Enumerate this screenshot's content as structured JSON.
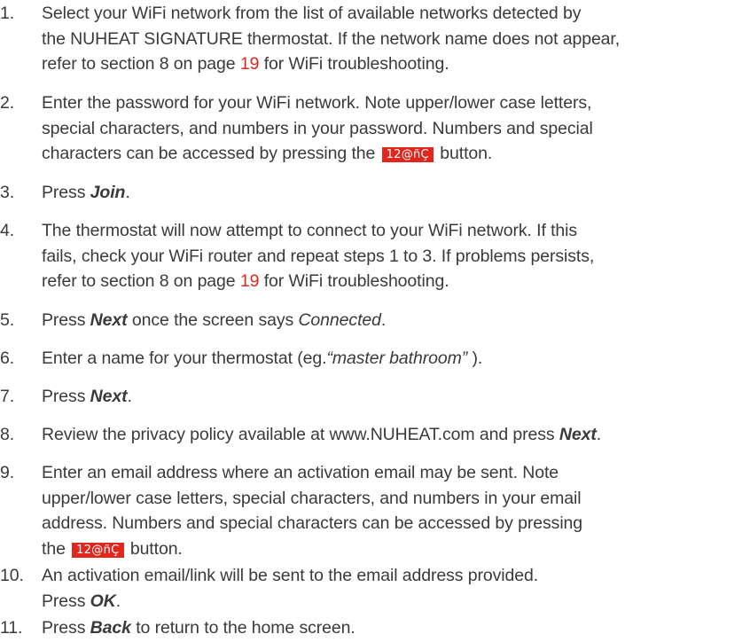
{
  "steps": [
    {
      "num": "1.",
      "line1": "Select your WiFi network from the list of available networks detected by",
      "line2": "the NUHEAT SIGNATURE thermostat. If the network name does not appear,",
      "line3_pre": "refer to section 8 on page ",
      "line3_link": "19",
      "line3_post": " for WiFi troubleshooting."
    },
    {
      "num": "2.",
      "line1": "Enter the password for your WiFi network. Note upper/lower case letters,",
      "line2": "special characters, and numbers in your password. Numbers and special",
      "line3_pre": "characters can be accessed by pressing the ",
      "line3_key": "12@ñÇ",
      "line3_post": " button."
    },
    {
      "num": "3.",
      "pre": "Press ",
      "bold": "Join",
      "post": "."
    },
    {
      "num": "4.",
      "line1": "The thermostat will now attempt to connect to your WiFi network. If this",
      "line2": "fails, check your WiFi router and repeat steps 1 to 3. If problems persists,",
      "line3_pre": "refer to section 8 on page ",
      "line3_link": "19",
      "line3_post": " for WiFi troubleshooting."
    },
    {
      "num": "5.",
      "pre": "Press ",
      "bold": "Next",
      "mid": " once the screen says ",
      "italic": "Connected",
      "post": "."
    },
    {
      "num": "6.",
      "pre": "Enter a name for your thermostat (eg.",
      "italic": "“master bathroom”",
      "post": " )."
    },
    {
      "num": "7.",
      "pre": "Press ",
      "bold": "Next",
      "post": "."
    },
    {
      "num": "8.",
      "pre": "Review the privacy policy available at www.NUHEAT.com and press ",
      "bold": "Next",
      "post": "."
    },
    {
      "num": "9.",
      "line1": "Enter an email address where an activation email may be sent. Note",
      "line2": "upper/lower case letters, special characters, and numbers in your email",
      "line3": "address. Numbers and special characters can be accessed by pressing",
      "line4_pre": "the ",
      "line4_key": "12@ñÇ",
      "line4_post": " button."
    },
    {
      "num": "10.",
      "line1": "An activation email/link will be sent to the email address provided.",
      "line2_pre": "Press ",
      "line2_bold": "OK",
      "line2_post": "."
    },
    {
      "num": "11.",
      "pre": "Press ",
      "bold": "Back",
      "post": " to return to the home screen."
    }
  ]
}
